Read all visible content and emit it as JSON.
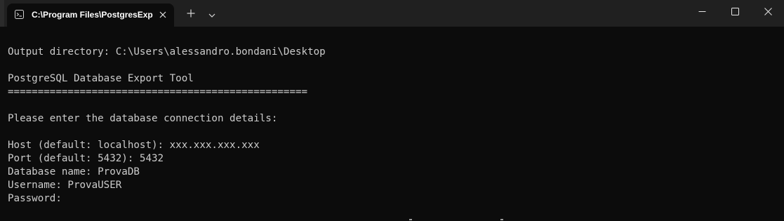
{
  "titlebar": {
    "tab": {
      "title": "C:\\Program Files\\PostgresExp",
      "icon": "terminal-icon"
    },
    "icons": {
      "close_tab": "close-icon",
      "new_tab": "plus-icon",
      "dropdown": "chevron-down-icon",
      "minimize": "minimize-icon",
      "maximize": "maximize-icon",
      "close_window": "close-icon"
    },
    "colors": {
      "titlebar_bg": "#202020",
      "tab_bg": "#0c0c0c"
    }
  },
  "terminal": {
    "lines": [
      "Output directory: C:\\Users\\alessandro.bondani\\Desktop",
      "PostgreSQL Database Export Tool",
      "==================================================",
      "Please enter the database connection details:",
      "Host (default: localhost): xxx.xxx.xxx.xxx",
      "Port (default: 5432): 5432",
      "Database name: ProvaDB",
      "Username: ProvaUSER",
      "Password:"
    ],
    "colors": {
      "background": "#0c0c0c",
      "foreground": "#cccccc"
    }
  }
}
